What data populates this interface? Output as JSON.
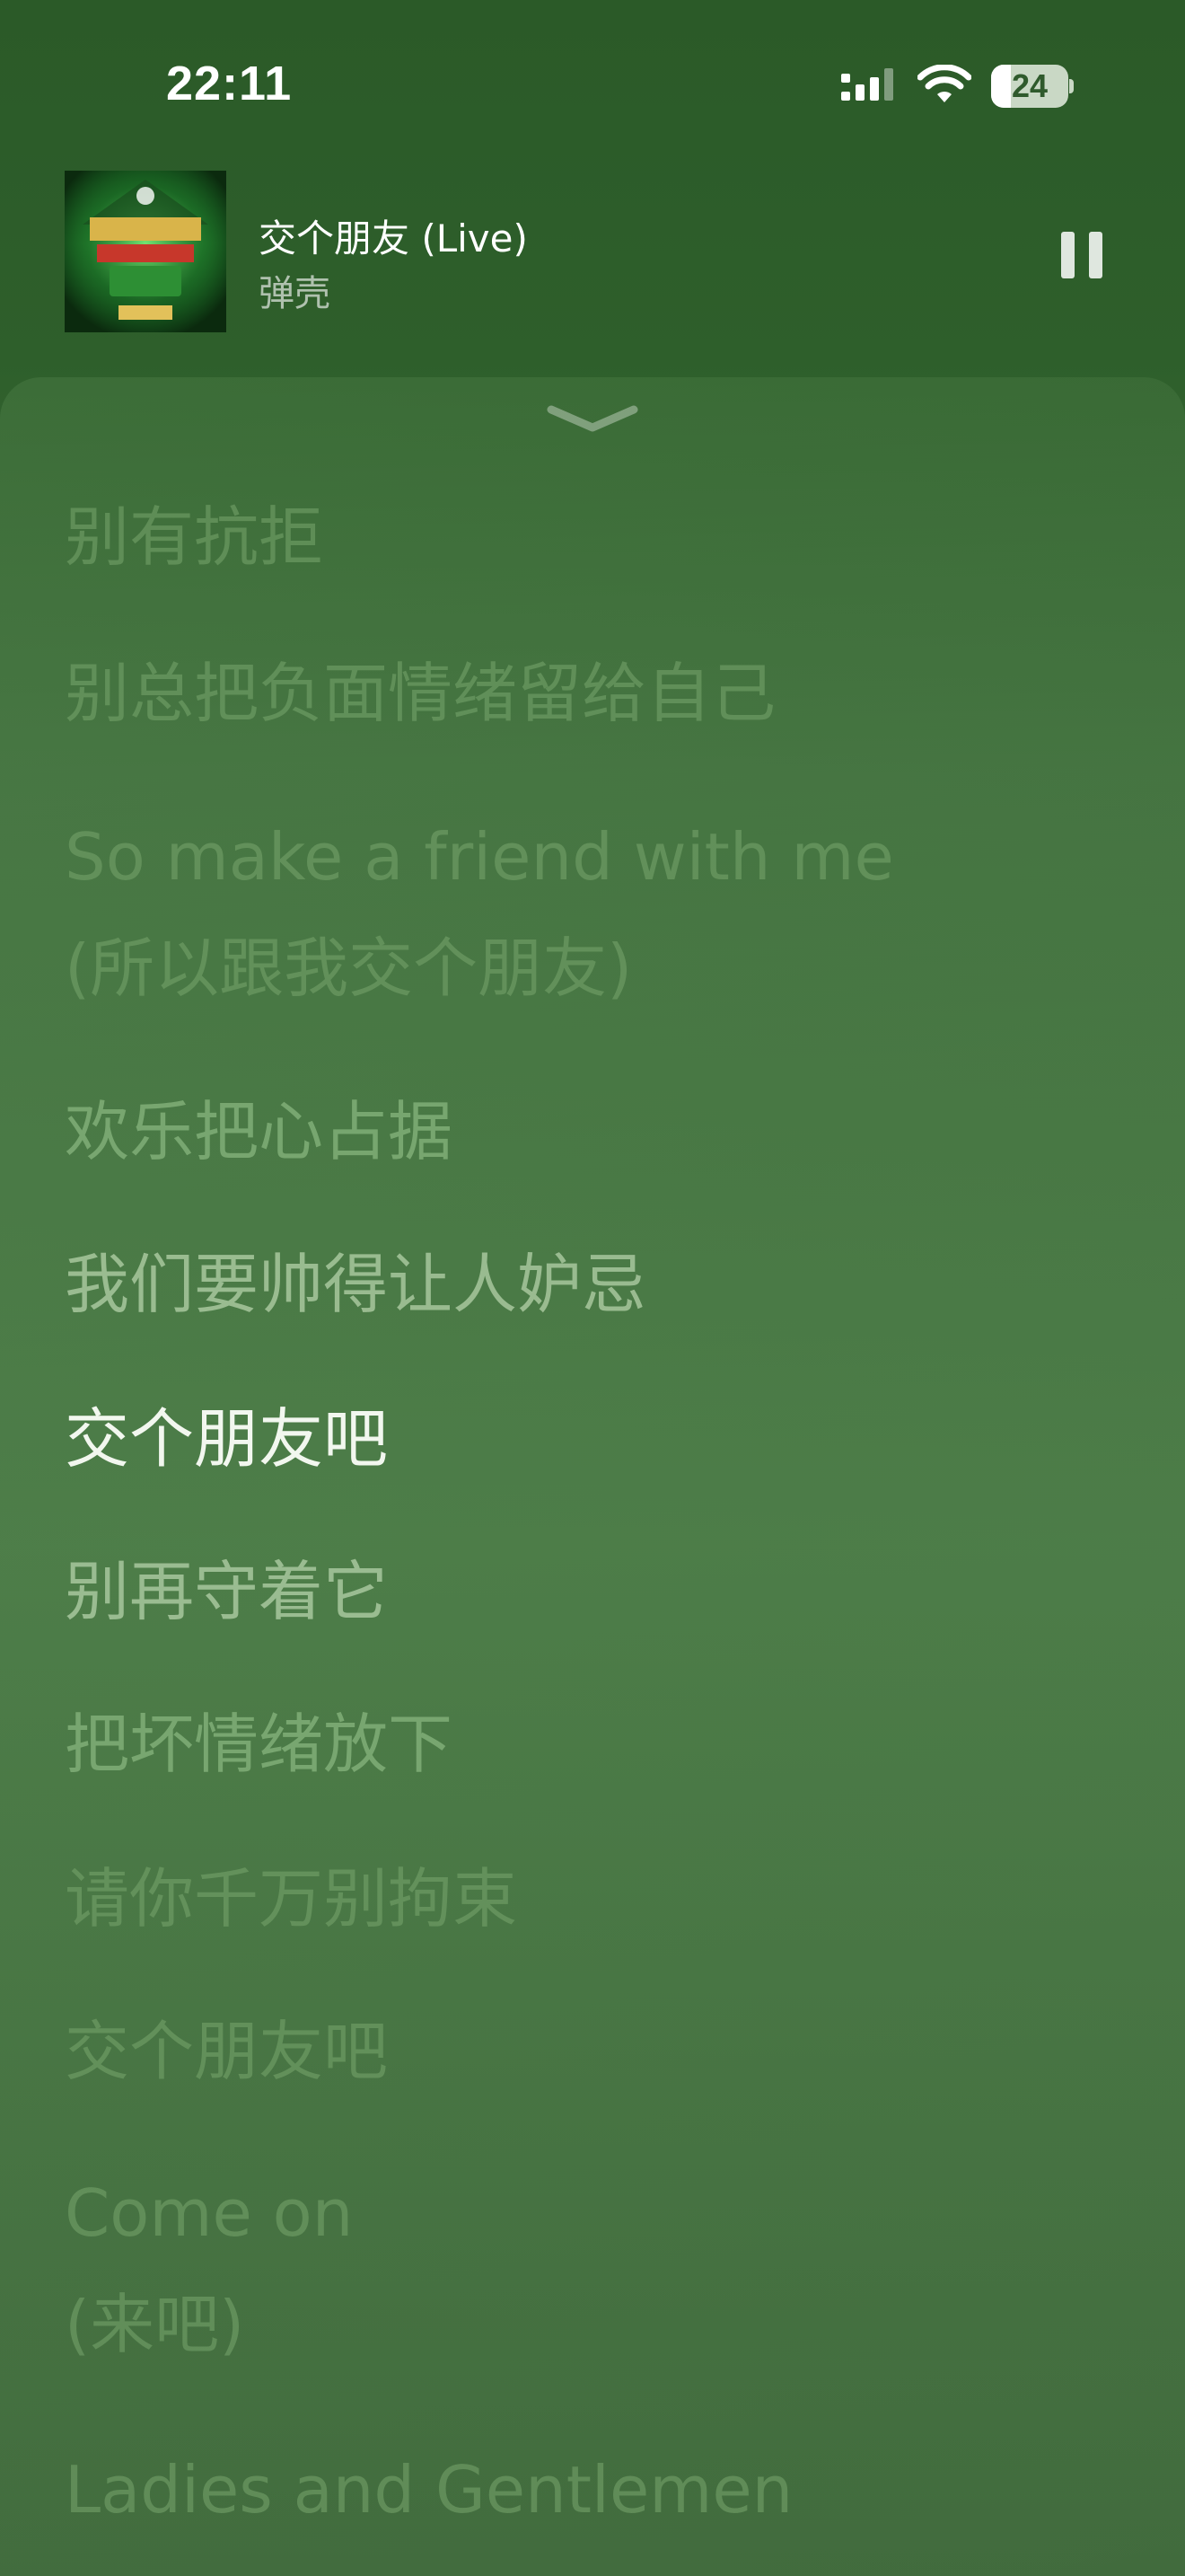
{
  "status_bar": {
    "time": "22:11",
    "battery_level": "24",
    "icons": [
      "signal-icon",
      "wifi-icon",
      "battery-icon"
    ]
  },
  "now_playing": {
    "title": "交个朋友 (Live)",
    "artist": "弹壳",
    "album_art": "album-art-rap-of-china",
    "pause_icon": "pause-icon"
  },
  "lyrics": {
    "lines": [
      {
        "text": "别有抗拒",
        "translation": ""
      },
      {
        "text": "别总把负面情绪留给自己",
        "translation": ""
      },
      {
        "text": "So make a friend with me",
        "translation": "(所以跟我交个朋友)"
      },
      {
        "text": "欢乐把心占据",
        "translation": ""
      },
      {
        "text": "我们要帅得让人妒忌",
        "translation": ""
      },
      {
        "text": "交个朋友吧",
        "translation": ""
      },
      {
        "text": "别再守着它",
        "translation": ""
      },
      {
        "text": "把坏情绪放下",
        "translation": ""
      },
      {
        "text": "请你千万别拘束",
        "translation": ""
      },
      {
        "text": "交个朋友吧",
        "translation": ""
      },
      {
        "text": "Come on",
        "translation": "(来吧)"
      },
      {
        "text": "Ladies and Gentlemen",
        "translation": ""
      }
    ],
    "active_index": 5
  },
  "colors": {
    "background": "#3f6e3c",
    "active_lyric": "#f2f7ef",
    "inactive_lyric": "#8cb982"
  }
}
